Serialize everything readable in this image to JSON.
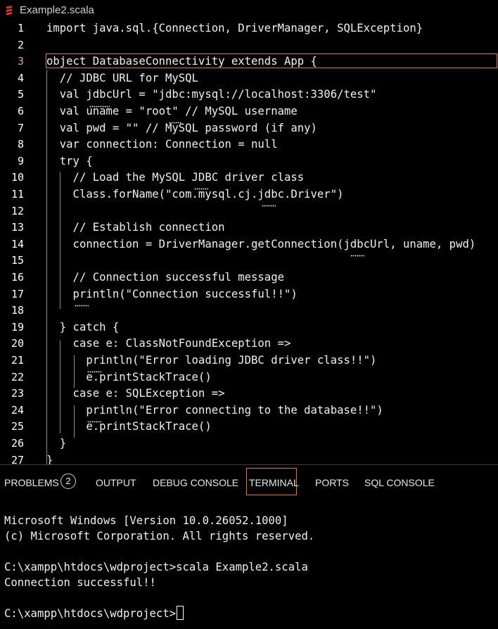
{
  "tab": {
    "filename": "Example2.scala",
    "icon": "scala-file-icon",
    "icon_color": "#de3423"
  },
  "editor": {
    "current_line": 3,
    "lines": [
      {
        "n": "1",
        "text": "import java.sql.{Connection, DriverManager, SQLException}"
      },
      {
        "n": "2",
        "text": ""
      },
      {
        "n": "3",
        "text": "object DatabaseConnectivity extends App {"
      },
      {
        "n": "4",
        "text": "  // JDBC URL for MySQL"
      },
      {
        "n": "5",
        "text": "  val jdbcUrl = \"jdbc:mysql://localhost:3306/test\""
      },
      {
        "n": "6",
        "text": "  val uname = \"root\" // MySQL username"
      },
      {
        "n": "7",
        "text": "  val pwd = \"\" // MySQL password (if any)"
      },
      {
        "n": "8",
        "text": "  var connection: Connection = null"
      },
      {
        "n": "9",
        "text": "  try {"
      },
      {
        "n": "10",
        "text": "    // Load the MySQL JDBC driver class"
      },
      {
        "n": "11",
        "text": "    Class.forName(\"com.mysql.cj.jdbc.Driver\")"
      },
      {
        "n": "12",
        "text": ""
      },
      {
        "n": "13",
        "text": "    // Establish connection"
      },
      {
        "n": "14",
        "text": "    connection = DriverManager.getConnection(jdbcUrl, uname, pwd)"
      },
      {
        "n": "15",
        "text": ""
      },
      {
        "n": "16",
        "text": "    // Connection successful message"
      },
      {
        "n": "17",
        "text": "    println(\"Connection successful!!\")"
      },
      {
        "n": "18",
        "text": ""
      },
      {
        "n": "19",
        "text": "  } catch {"
      },
      {
        "n": "20",
        "text": "    case e: ClassNotFoundException =>"
      },
      {
        "n": "21",
        "text": "      println(\"Error loading JDBC driver class!!\")"
      },
      {
        "n": "22",
        "text": "      e.printStackTrace()"
      },
      {
        "n": "23",
        "text": "    case e: SQLException =>"
      },
      {
        "n": "24",
        "text": "      println(\"Error connecting to the database!!\")"
      },
      {
        "n": "25",
        "text": "      e.printStackTrace()"
      },
      {
        "n": "26",
        "text": "  }"
      },
      {
        "n": "27",
        "text": "}"
      }
    ]
  },
  "panel": {
    "tabs": {
      "problems": "PROBLEMS",
      "problems_count": "2",
      "output": "OUTPUT",
      "debug_console": "DEBUG CONSOLE",
      "terminal": "TERMINAL",
      "ports": "PORTS",
      "sql_console": "SQL CONSOLE"
    },
    "active_tab": "TERMINAL",
    "accent_color": "#d97a3a",
    "terminal": {
      "lines": [
        "Microsoft Windows [Version 10.0.26052.1000]",
        "(c) Microsoft Corporation. All rights reserved.",
        "",
        "C:\\xampp\\htdocs\\wdproject>scala Example2.scala",
        "Connection successful!!",
        "",
        "C:\\xampp\\htdocs\\wdproject>"
      ]
    }
  }
}
